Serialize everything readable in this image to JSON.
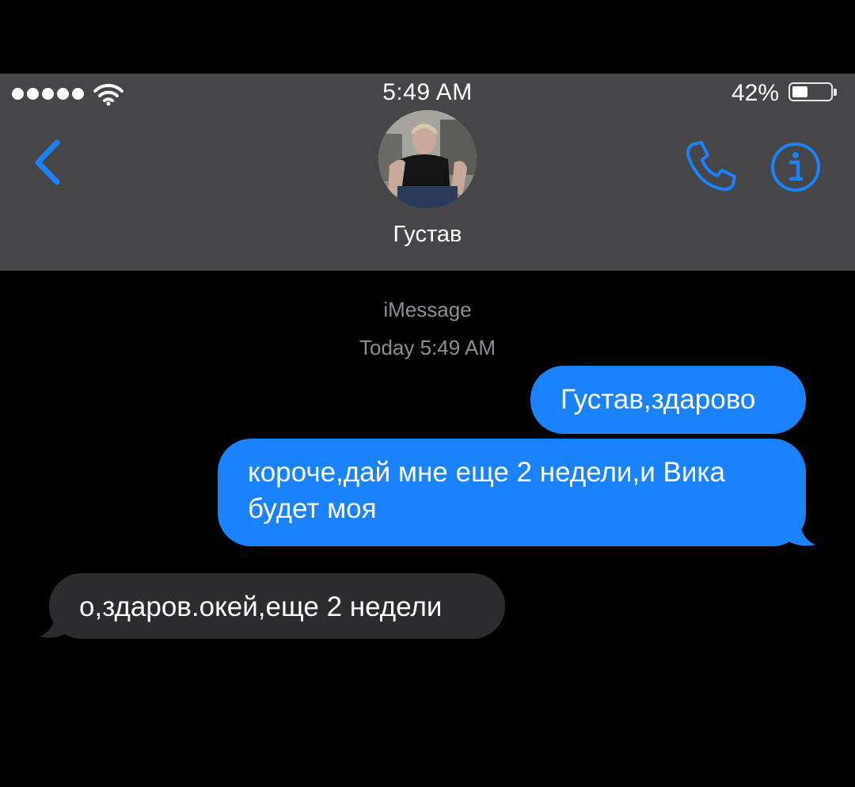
{
  "status_bar": {
    "signal_bars": 5,
    "time": "5:49 AM",
    "battery_percent": "42%",
    "battery_level": 0.42
  },
  "nav": {
    "back_icon": "chevron-left-icon",
    "contact_name": "Густав",
    "call_icon": "phone-icon",
    "info_icon": "info-icon",
    "accent_color": "#1a82fb"
  },
  "conversation": {
    "service": "iMessage",
    "timestamp": "Today 5:49 AM",
    "messages": [
      {
        "direction": "outgoing",
        "text": "Густав,здарово"
      },
      {
        "direction": "outgoing",
        "text": "короче,дай мне еще 2 недели,и Вика будет моя"
      },
      {
        "direction": "incoming",
        "text": "о,здаров.окей,еще 2 недели"
      }
    ]
  },
  "colors": {
    "header_bg": "#464548",
    "outgoing_bubble": "#1a82fb",
    "incoming_bubble": "#2c2c2f",
    "meta_text": "#8e8e93"
  }
}
